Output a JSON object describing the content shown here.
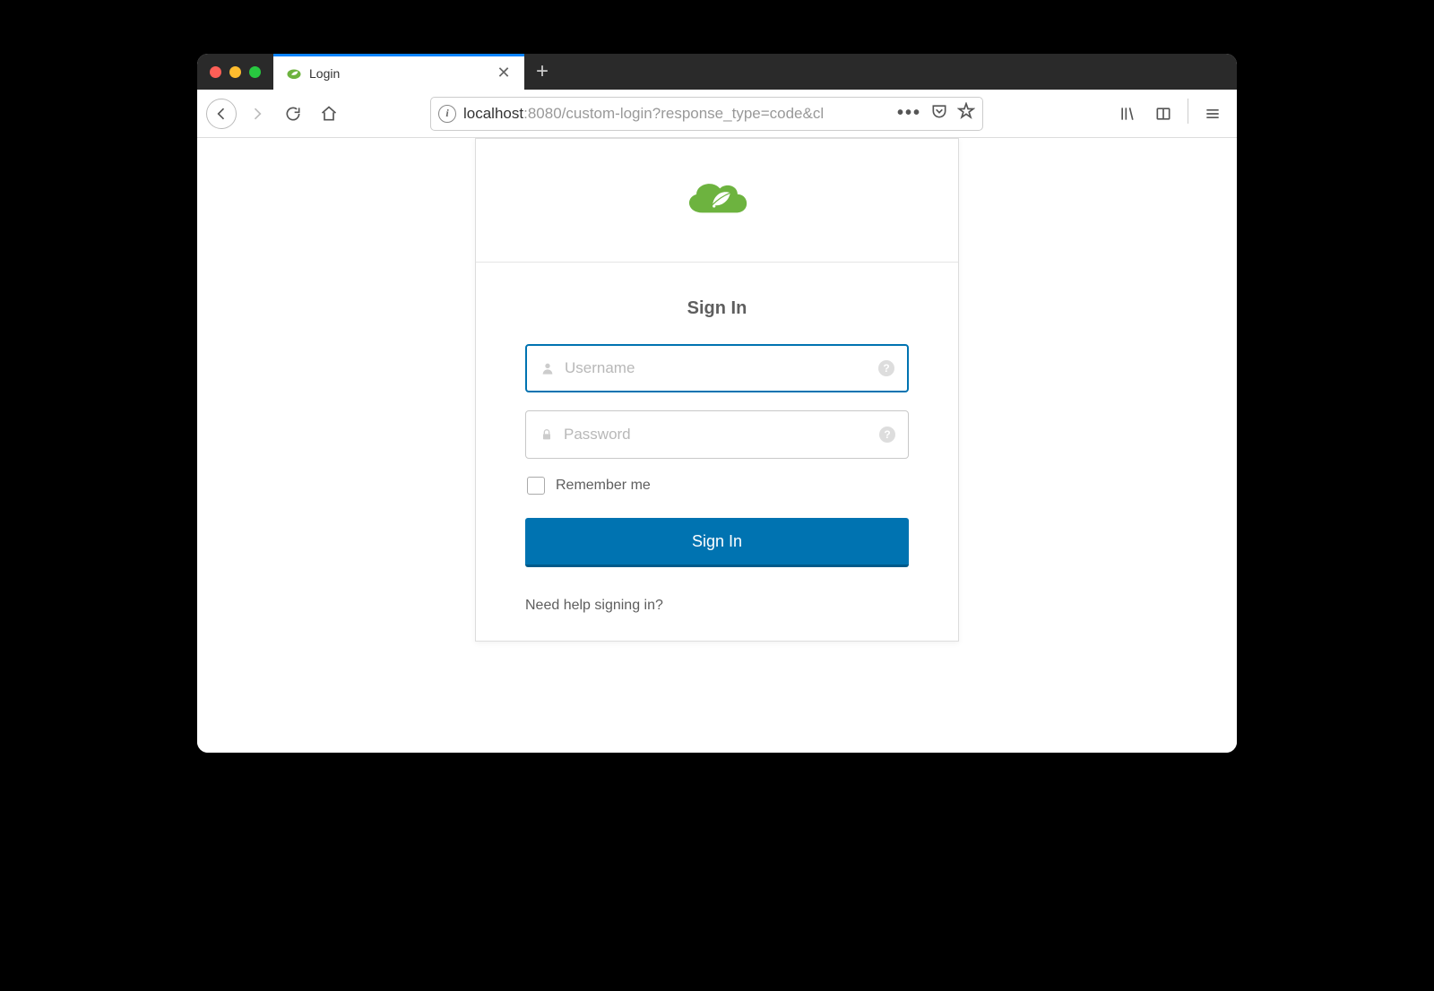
{
  "browser": {
    "tab_title": "Login",
    "url_host": "localhost",
    "url_path": ":8080/custom-login?response_type=code&cl"
  },
  "login": {
    "heading": "Sign In",
    "username_placeholder": "Username",
    "password_placeholder": "Password",
    "remember_label": "Remember me",
    "submit_label": "Sign In",
    "help_link": "Need help signing in?"
  },
  "colors": {
    "primary": "#0073b1",
    "logo_green": "#6db33f"
  }
}
